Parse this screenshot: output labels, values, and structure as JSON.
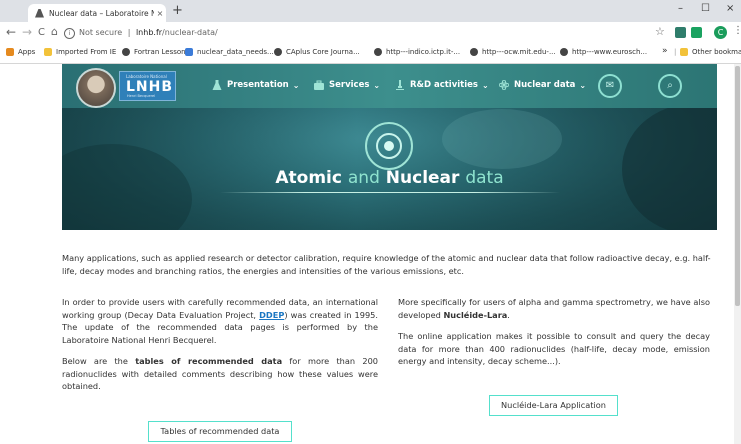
{
  "browser": {
    "tab_title": "Nuclear data – Laboratoire Natio",
    "tab_close": "×",
    "new_tab": "+",
    "window_controls": {
      "minimize": "–",
      "maximize": "☐",
      "close": "×"
    },
    "nav": {
      "back": "←",
      "forward": "→",
      "reload": "C",
      "home": "⌂"
    },
    "security_label": "Not secure",
    "url_separator": "|",
    "url_host": "lnhb.fr",
    "url_path": "/nuclear-data/",
    "star": "☆",
    "avatar_letter": "C",
    "menu": "⋮",
    "bookmarks": [
      "Apps",
      "Imported From IE",
      "Fortran Lesson",
      "nuclear_data_needs...",
      "CAplus Core Journa...",
      "http---indico.ictp.it-...",
      "http---ocw.mit.edu-...",
      "http---www.eurosch..."
    ],
    "bookmarks_overflow": "»",
    "other_bookmarks": "Other bookmarks"
  },
  "site": {
    "logo": {
      "small": "Laboratoire National",
      "big": "LNHB",
      "sub": "Henri Becquerel"
    },
    "menu": [
      {
        "label": "Presentation",
        "chevron": "⌄"
      },
      {
        "label": "Services",
        "chevron": "⌄"
      },
      {
        "label": "R&D activities",
        "chevron": "⌄"
      },
      {
        "label": "Nuclear data",
        "chevron": "⌄"
      }
    ],
    "mail_icon": "✉",
    "search_icon": "⌕",
    "hero": {
      "title_a": "Atomic",
      "title_b": "and",
      "title_c": "Nuclear",
      "title_d": "data"
    }
  },
  "content": {
    "intro": "Many applications, such as applied research or detector calibration, require knowledge of the atomic and nuclear data that follow radioactive decay, e.g. half-life, decay modes and branching ratios, the energies and intensities of the various emissions, etc.",
    "left_p1_a": "In order to provide users with carefully recommended data, an international working group (Decay Data Evaluation Project,",
    "left_p1_link": "DDEP",
    "left_p1_b": ") was created in 1995. The update of the recommended data pages is performed by the Laboratoire National Henri Becquerel.",
    "left_p2_a": "Below are the",
    "left_p2_bold": "tables of recommended data",
    "left_p2_b": "for more than 200 radionuclides with detailed comments describing how these values were obtained.",
    "left_button": "Tables of recommended data",
    "right_p1_a": "More specifically for users of alpha and gamma spectrometry, we have also developed",
    "right_p1_bold": "Nucléide-Lara",
    "right_p1_b": ".",
    "right_p2": "The online application makes it possible to consult and query the decay data for more than 400 radionuclides (half-life, decay mode, emission energy and intensity, decay scheme...).",
    "right_button": "Nucléide-Lara Application"
  },
  "colors": {
    "accent": "#55e0cc",
    "link": "#1a76c2",
    "brand_blue": "#2f80b9"
  }
}
